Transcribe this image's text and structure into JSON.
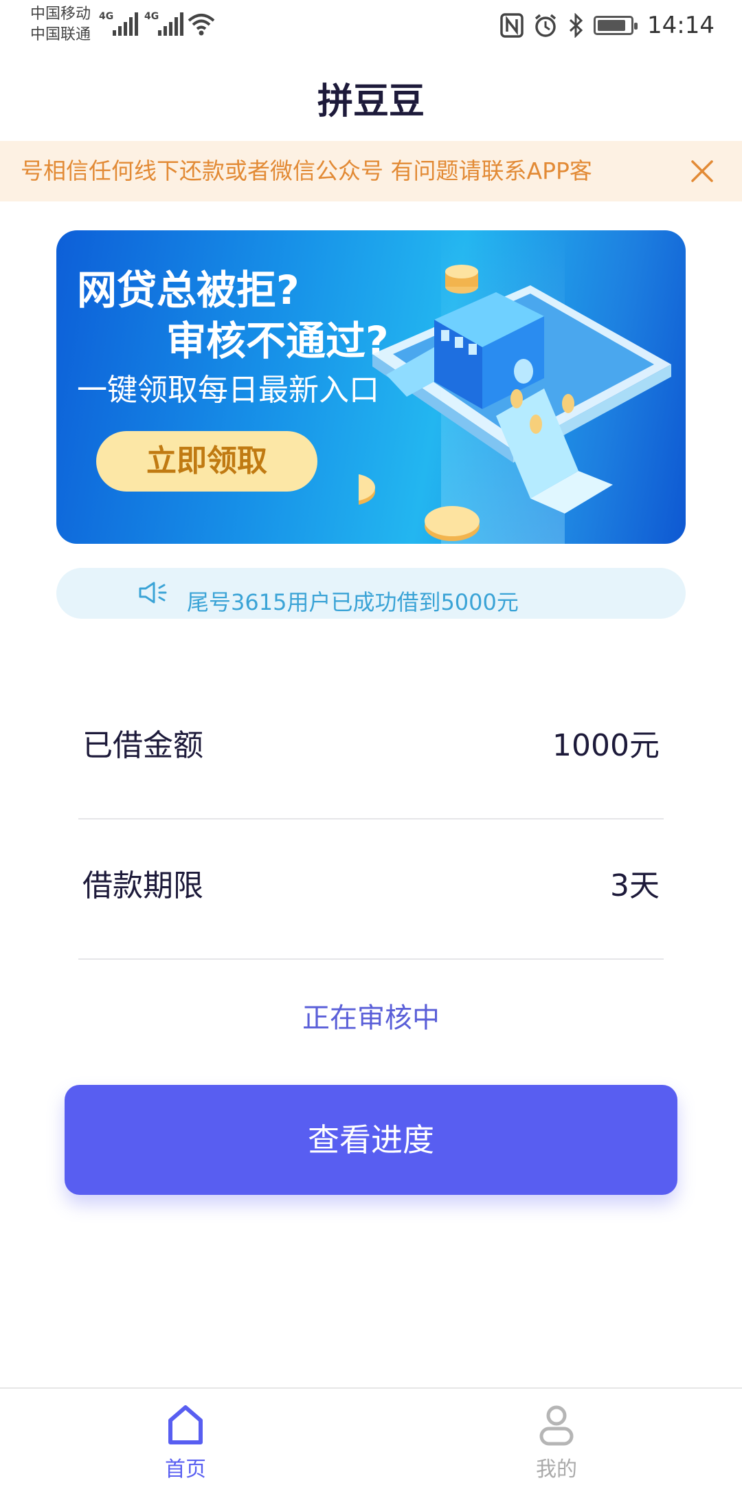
{
  "status_bar": {
    "carrier_1": "中国移动",
    "carrier_2": "中国联通",
    "network_1": "4G",
    "network_2": "4G",
    "time": "14:14",
    "icons": [
      "signal-icon",
      "wifi-icon",
      "nfc-icon",
      "alarm-icon",
      "bluetooth-icon",
      "battery-icon"
    ]
  },
  "header": {
    "title": "拼豆豆"
  },
  "notice": {
    "text": "号相信任何线下还款或者微信公众号 有问题请联系APP客",
    "color": "#e28a35",
    "background": "#fdf1e3"
  },
  "banner": {
    "line1": "网贷总被拒?",
    "line2": "审核不通过?",
    "line3": "一键领取每日最新入口",
    "cta_label": "立即领取"
  },
  "broadcast": {
    "message": "尾号3615用户已成功借到5000元"
  },
  "loan": {
    "amount_label": "已借金额",
    "amount_value": "1000元",
    "term_label": "借款期限",
    "term_value": "3天",
    "status": "正在审核中"
  },
  "progress_button": {
    "label": "查看进度",
    "color": "#585ef1"
  },
  "tabbar": {
    "home_label": "首页",
    "mine_label": "我的",
    "active": "home"
  }
}
